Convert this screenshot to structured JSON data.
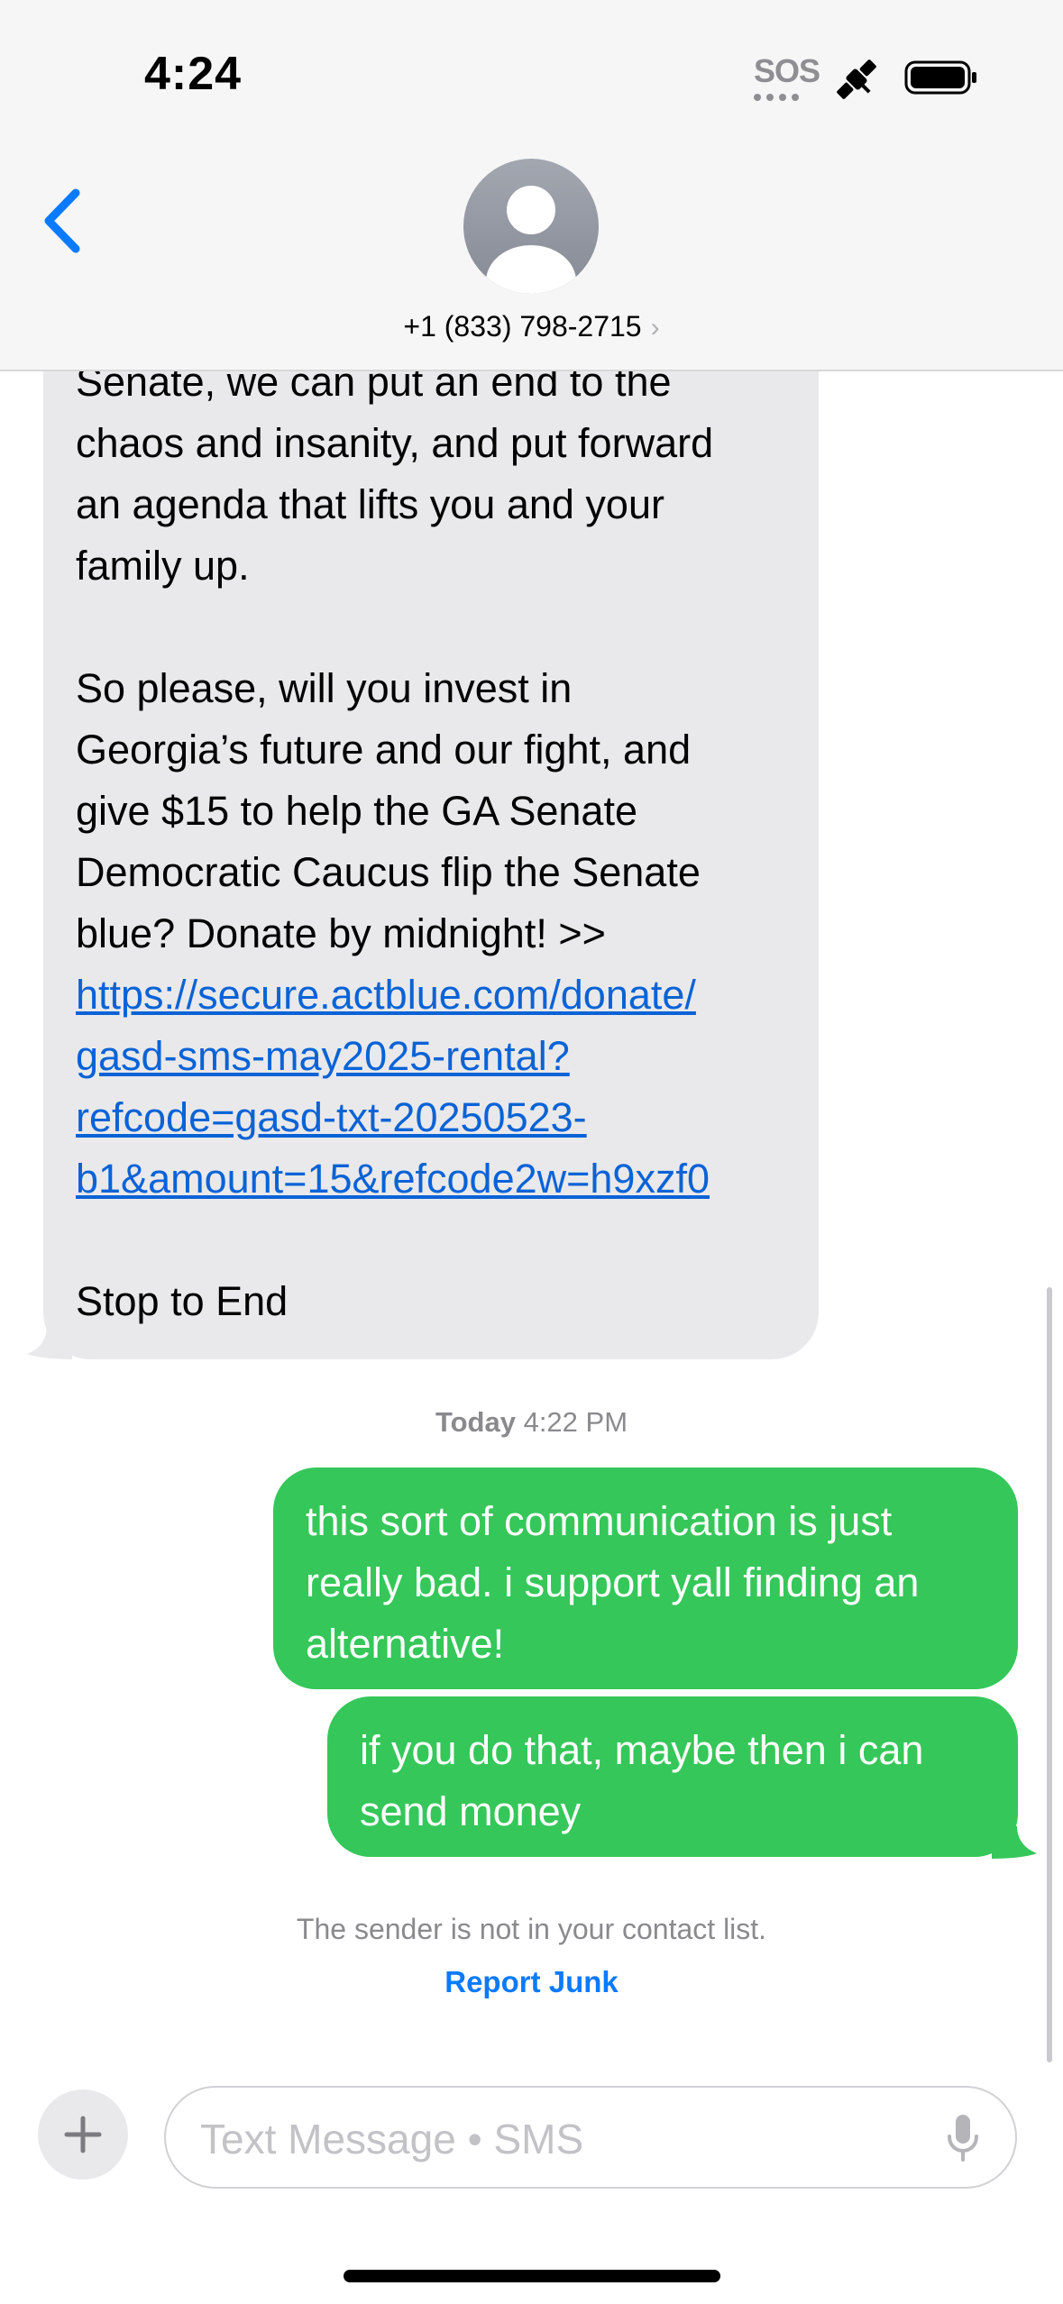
{
  "status_bar": {
    "time": "4:24",
    "sos_label": "SOS",
    "icons": [
      "satellite-icon",
      "battery-icon"
    ]
  },
  "header": {
    "contact": "+1 (833) 798-2715",
    "chevron": "›",
    "icons": [
      "back-chevron-icon",
      "avatar-person-icon"
    ]
  },
  "conversation": {
    "incoming": {
      "paragraph1": "Senate, we can put an end to the\nchaos and insanity, and put forward\nan agenda that lifts you and your\nfamily up.",
      "paragraph2": "So please, will you invest in\nGeorgia’s future and our fight, and\ngive $15 to help the GA Senate\nDemocratic Caucus flip the Senate\nblue? Donate by midnight! >>",
      "link": "https://secure.actblue.com/donate/\ngasd-sms-may2025-rental?\nrefcode=gasd-txt-20250523-\nb1&amount=15&refcode2w=h9xzf0",
      "footer": "Stop to End"
    },
    "timestamp_day": "Today",
    "timestamp_time": "4:22 PM",
    "outgoing": [
      "this sort of communication is just\nreally bad. i support yall finding an\nalternative!",
      "if you do that, maybe then i can\nsend money"
    ],
    "notice": "The sender is not in your contact list.",
    "report_label": "Report Junk"
  },
  "input_bar": {
    "placeholder": "Text Message • SMS",
    "icons": [
      "plus-icon",
      "microphone-icon"
    ]
  },
  "colors": {
    "outgoing_bubble": "#35c759",
    "incoming_bubble": "#e9e9eb",
    "link": "#0a63d6",
    "accent": "#0a7aff"
  }
}
